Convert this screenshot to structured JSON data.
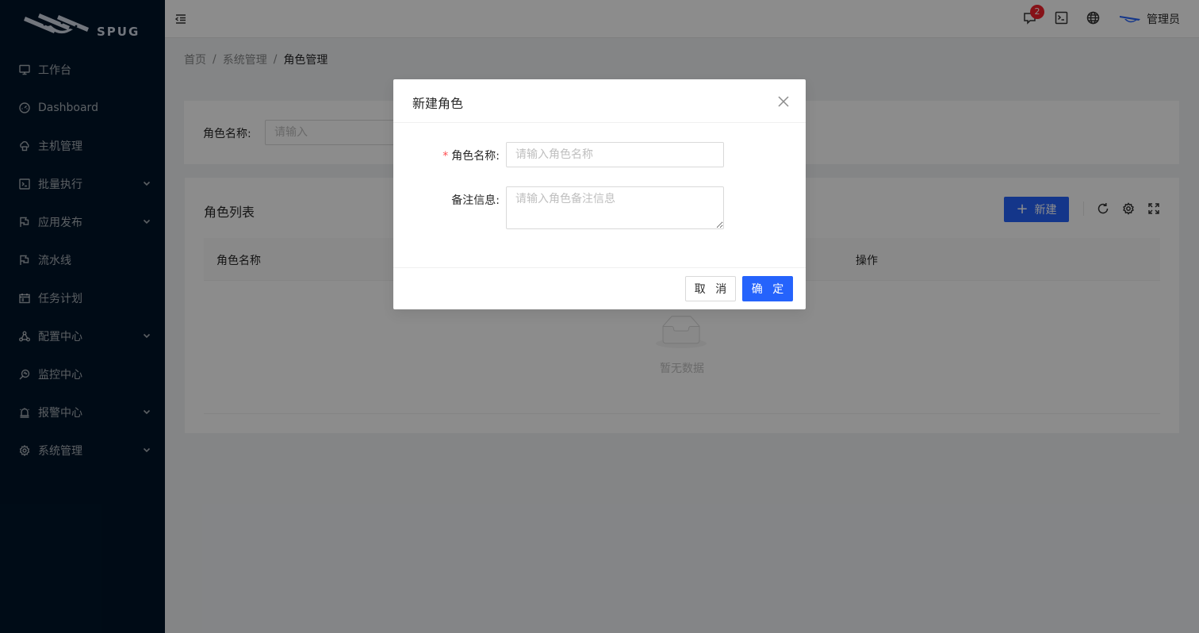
{
  "brand": {
    "logo_text": "SPUG"
  },
  "sidebar": {
    "items": [
      {
        "label": "工作台",
        "icon": "desktop-icon",
        "submenu": false
      },
      {
        "label": "Dashboard",
        "icon": "dashboard-icon",
        "submenu": false
      },
      {
        "label": "主机管理",
        "icon": "cloud-server-icon",
        "submenu": false
      },
      {
        "label": "批量执行",
        "icon": "code-icon",
        "submenu": true
      },
      {
        "label": "应用发布",
        "icon": "flag-icon",
        "submenu": true
      },
      {
        "label": "流水线",
        "icon": "flag-icon",
        "submenu": false
      },
      {
        "label": "任务计划",
        "icon": "schedule-icon",
        "submenu": false
      },
      {
        "label": "配置中心",
        "icon": "deployment-icon",
        "submenu": true
      },
      {
        "label": "监控中心",
        "icon": "monitor-icon",
        "submenu": false
      },
      {
        "label": "报警中心",
        "icon": "alert-icon",
        "submenu": true
      },
      {
        "label": "系统管理",
        "icon": "setting-icon",
        "submenu": true
      }
    ]
  },
  "header": {
    "notification_count": "2",
    "user_name": "管理员"
  },
  "breadcrumb": {
    "items": [
      "首页",
      "系统管理",
      "角色管理"
    ],
    "separator": "/"
  },
  "search": {
    "label": "角色名称:",
    "placeholder": "请输入"
  },
  "table": {
    "title": "角色列表",
    "new_button": "新建",
    "columns": [
      "角色名称",
      "操作"
    ],
    "empty_text": "暂无数据"
  },
  "modal": {
    "title": "新建角色",
    "fields": {
      "name_label": "角色名称",
      "name_placeholder": "请输入角色名称",
      "desc_label": "备注信息",
      "desc_placeholder": "请输入角色备注信息"
    },
    "cancel_label": "取 消",
    "ok_label": "确 定"
  },
  "colors": {
    "primary": "#2563fc",
    "sidebar_bg": "#001529",
    "badge": "#f5222d"
  }
}
